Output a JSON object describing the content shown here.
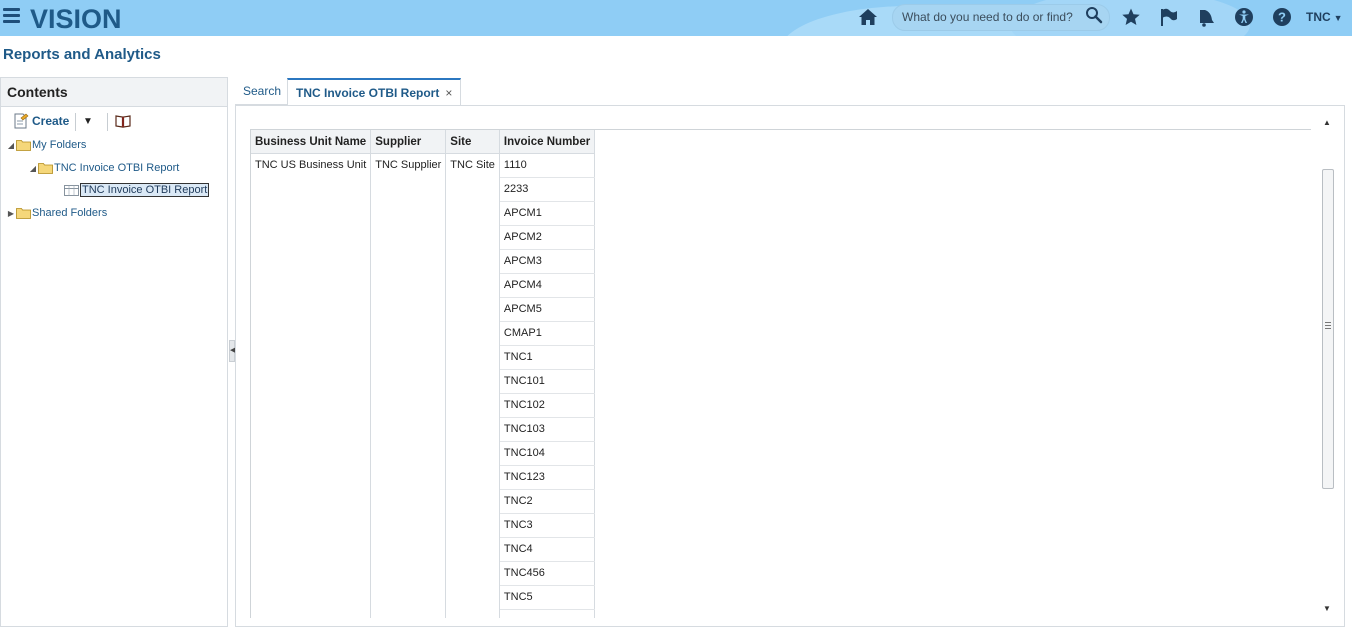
{
  "header": {
    "logo_text": "VISION",
    "search_placeholder": "What do you need to do or find?",
    "user_label": "TNC",
    "icons": [
      "hamburger-icon",
      "home-icon",
      "search-icon",
      "favorites-star-icon",
      "watchlist-flag-icon",
      "notifications-bell-icon",
      "accessibility-icon",
      "help-icon"
    ]
  },
  "page": {
    "title": "Reports and Analytics"
  },
  "left_panel": {
    "header": "Contents",
    "toolbar": {
      "create_label": "Create"
    },
    "tree": {
      "my_folders": "My Folders",
      "report_folder": "TNC Invoice OTBI Report",
      "report_item": "TNC Invoice OTBI Report",
      "shared_folders": "Shared Folders"
    }
  },
  "tabs": [
    {
      "label": "Search"
    },
    {
      "label": "TNC Invoice OTBI Report",
      "active": true,
      "close": "×"
    }
  ],
  "report": {
    "columns": [
      "Business Unit Name",
      "Supplier",
      "Site",
      "Invoice Number"
    ],
    "business_unit": "TNC US Business Unit",
    "supplier": "TNC Supplier",
    "site": "TNC Site",
    "invoice_numbers": [
      "1110",
      "2233",
      "APCM1",
      "APCM2",
      "APCM3",
      "APCM4",
      "APCM5",
      "CMAP1",
      "TNC1",
      "TNC101",
      "TNC102",
      "TNC103",
      "TNC104",
      "TNC123",
      "TNC2",
      "TNC3",
      "TNC4",
      "TNC456",
      "TNC5"
    ]
  },
  "colors": {
    "topbar": "#8fcdf5",
    "brand": "#1f5a88",
    "active_tab_border": "#2b77c0"
  }
}
